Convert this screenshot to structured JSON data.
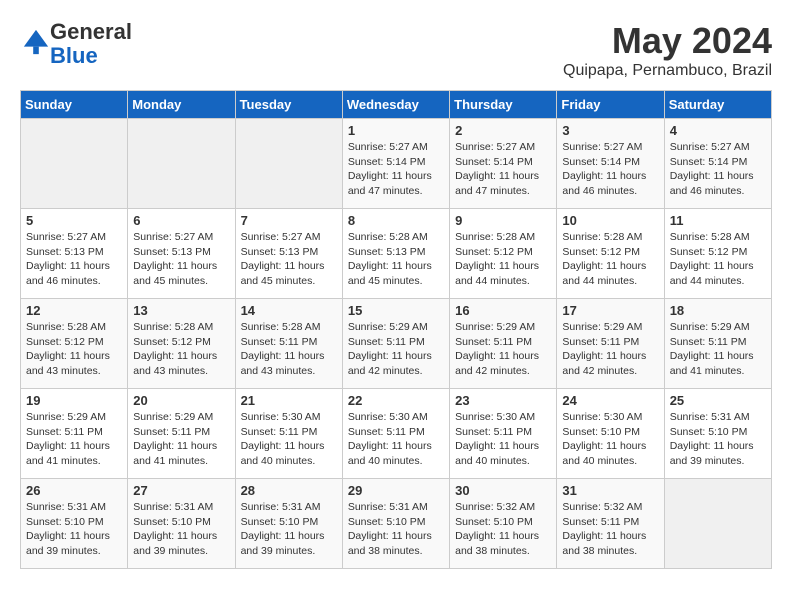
{
  "header": {
    "logo_general": "General",
    "logo_blue": "Blue",
    "month_title": "May 2024",
    "location": "Quipapa, Pernambuco, Brazil"
  },
  "weekdays": [
    "Sunday",
    "Monday",
    "Tuesday",
    "Wednesday",
    "Thursday",
    "Friday",
    "Saturday"
  ],
  "weeks": [
    [
      {
        "day": null,
        "sunrise": null,
        "sunset": null,
        "daylight": null
      },
      {
        "day": null,
        "sunrise": null,
        "sunset": null,
        "daylight": null
      },
      {
        "day": null,
        "sunrise": null,
        "sunset": null,
        "daylight": null
      },
      {
        "day": "1",
        "sunrise": "5:27 AM",
        "sunset": "5:14 PM",
        "daylight": "11 hours and 47 minutes."
      },
      {
        "day": "2",
        "sunrise": "5:27 AM",
        "sunset": "5:14 PM",
        "daylight": "11 hours and 47 minutes."
      },
      {
        "day": "3",
        "sunrise": "5:27 AM",
        "sunset": "5:14 PM",
        "daylight": "11 hours and 46 minutes."
      },
      {
        "day": "4",
        "sunrise": "5:27 AM",
        "sunset": "5:14 PM",
        "daylight": "11 hours and 46 minutes."
      }
    ],
    [
      {
        "day": "5",
        "sunrise": "5:27 AM",
        "sunset": "5:13 PM",
        "daylight": "11 hours and 46 minutes."
      },
      {
        "day": "6",
        "sunrise": "5:27 AM",
        "sunset": "5:13 PM",
        "daylight": "11 hours and 45 minutes."
      },
      {
        "day": "7",
        "sunrise": "5:27 AM",
        "sunset": "5:13 PM",
        "daylight": "11 hours and 45 minutes."
      },
      {
        "day": "8",
        "sunrise": "5:28 AM",
        "sunset": "5:13 PM",
        "daylight": "11 hours and 45 minutes."
      },
      {
        "day": "9",
        "sunrise": "5:28 AM",
        "sunset": "5:12 PM",
        "daylight": "11 hours and 44 minutes."
      },
      {
        "day": "10",
        "sunrise": "5:28 AM",
        "sunset": "5:12 PM",
        "daylight": "11 hours and 44 minutes."
      },
      {
        "day": "11",
        "sunrise": "5:28 AM",
        "sunset": "5:12 PM",
        "daylight": "11 hours and 44 minutes."
      }
    ],
    [
      {
        "day": "12",
        "sunrise": "5:28 AM",
        "sunset": "5:12 PM",
        "daylight": "11 hours and 43 minutes."
      },
      {
        "day": "13",
        "sunrise": "5:28 AM",
        "sunset": "5:12 PM",
        "daylight": "11 hours and 43 minutes."
      },
      {
        "day": "14",
        "sunrise": "5:28 AM",
        "sunset": "5:11 PM",
        "daylight": "11 hours and 43 minutes."
      },
      {
        "day": "15",
        "sunrise": "5:29 AM",
        "sunset": "5:11 PM",
        "daylight": "11 hours and 42 minutes."
      },
      {
        "day": "16",
        "sunrise": "5:29 AM",
        "sunset": "5:11 PM",
        "daylight": "11 hours and 42 minutes."
      },
      {
        "day": "17",
        "sunrise": "5:29 AM",
        "sunset": "5:11 PM",
        "daylight": "11 hours and 42 minutes."
      },
      {
        "day": "18",
        "sunrise": "5:29 AM",
        "sunset": "5:11 PM",
        "daylight": "11 hours and 41 minutes."
      }
    ],
    [
      {
        "day": "19",
        "sunrise": "5:29 AM",
        "sunset": "5:11 PM",
        "daylight": "11 hours and 41 minutes."
      },
      {
        "day": "20",
        "sunrise": "5:29 AM",
        "sunset": "5:11 PM",
        "daylight": "11 hours and 41 minutes."
      },
      {
        "day": "21",
        "sunrise": "5:30 AM",
        "sunset": "5:11 PM",
        "daylight": "11 hours and 40 minutes."
      },
      {
        "day": "22",
        "sunrise": "5:30 AM",
        "sunset": "5:11 PM",
        "daylight": "11 hours and 40 minutes."
      },
      {
        "day": "23",
        "sunrise": "5:30 AM",
        "sunset": "5:11 PM",
        "daylight": "11 hours and 40 minutes."
      },
      {
        "day": "24",
        "sunrise": "5:30 AM",
        "sunset": "5:10 PM",
        "daylight": "11 hours and 40 minutes."
      },
      {
        "day": "25",
        "sunrise": "5:31 AM",
        "sunset": "5:10 PM",
        "daylight": "11 hours and 39 minutes."
      }
    ],
    [
      {
        "day": "26",
        "sunrise": "5:31 AM",
        "sunset": "5:10 PM",
        "daylight": "11 hours and 39 minutes."
      },
      {
        "day": "27",
        "sunrise": "5:31 AM",
        "sunset": "5:10 PM",
        "daylight": "11 hours and 39 minutes."
      },
      {
        "day": "28",
        "sunrise": "5:31 AM",
        "sunset": "5:10 PM",
        "daylight": "11 hours and 39 minutes."
      },
      {
        "day": "29",
        "sunrise": "5:31 AM",
        "sunset": "5:10 PM",
        "daylight": "11 hours and 38 minutes."
      },
      {
        "day": "30",
        "sunrise": "5:32 AM",
        "sunset": "5:10 PM",
        "daylight": "11 hours and 38 minutes."
      },
      {
        "day": "31",
        "sunrise": "5:32 AM",
        "sunset": "5:11 PM",
        "daylight": "11 hours and 38 minutes."
      },
      {
        "day": null,
        "sunrise": null,
        "sunset": null,
        "daylight": null
      }
    ]
  ],
  "labels": {
    "sunrise": "Sunrise: ",
    "sunset": "Sunset: ",
    "daylight": "Daylight: "
  }
}
